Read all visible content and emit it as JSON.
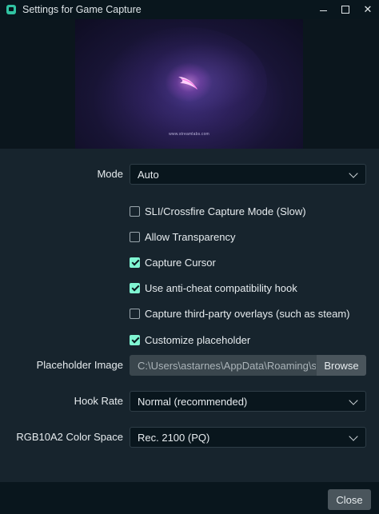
{
  "window": {
    "title": "Settings for Game Capture",
    "controls": {
      "minimize": "minimize",
      "maximize": "maximize",
      "close": "✕"
    }
  },
  "preview": {
    "caption": "www.streamlabs.com",
    "colors": {
      "background": "#1c1640",
      "glow": "#ff9cf2"
    }
  },
  "form": {
    "mode": {
      "label": "Mode",
      "value": "Auto"
    },
    "checkboxes": [
      {
        "label": "SLI/Crossfire Capture Mode (Slow)",
        "checked": false
      },
      {
        "label": "Allow Transparency",
        "checked": false
      },
      {
        "label": "Capture Cursor",
        "checked": true
      },
      {
        "label": "Use anti-cheat compatibility hook",
        "checked": true
      },
      {
        "label": "Capture third-party overlays (such as steam)",
        "checked": false
      },
      {
        "label": "Customize placeholder",
        "checked": true
      }
    ],
    "placeholder_image": {
      "label": "Placeholder Image",
      "value": "C:\\Users\\astarnes\\AppData\\Roaming\\slobs-client\\placeholder.png",
      "browse_label": "Browse"
    },
    "hook_rate": {
      "label": "Hook Rate",
      "value": "Normal (recommended)"
    },
    "color_space": {
      "label": "RGB10A2 Color Space",
      "value": "Rec. 2100 (PQ)"
    }
  },
  "footer": {
    "close_label": "Close"
  },
  "colors": {
    "accent": "#80f5d2",
    "panel": "#17242d",
    "titlebar": "#09161d"
  }
}
